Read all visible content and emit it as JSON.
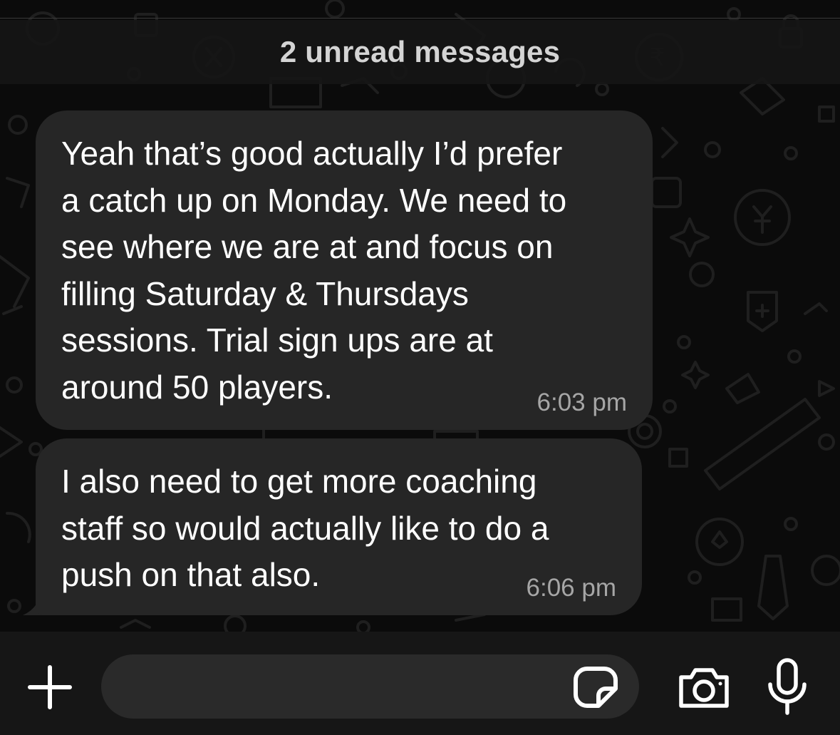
{
  "banner": {
    "unread_text": "2 unread messages"
  },
  "messages": [
    {
      "text": "Yeah that’s good actually I’d prefer\na catch up on Monday. We need to\nsee where we are at and focus on\nfilling Saturday & Thursdays\nsessions. Trial sign ups are at\naround 50 players.",
      "time": "6:03 pm"
    },
    {
      "text": "I also need to get more coaching\nstaff so would actually like to do a\npush on that also.",
      "time": "6:06 pm"
    }
  ],
  "composer": {
    "input_value": "",
    "icons": {
      "attach": "plus-icon",
      "sticker": "sticker-icon",
      "camera": "camera-icon",
      "voice": "microphone-icon"
    }
  },
  "colors": {
    "background": "#0b0b0b",
    "bubble": "#262626",
    "message_text": "#ffffff",
    "timestamp": "#a6a6a6",
    "banner_text": "#d4d4d4"
  }
}
